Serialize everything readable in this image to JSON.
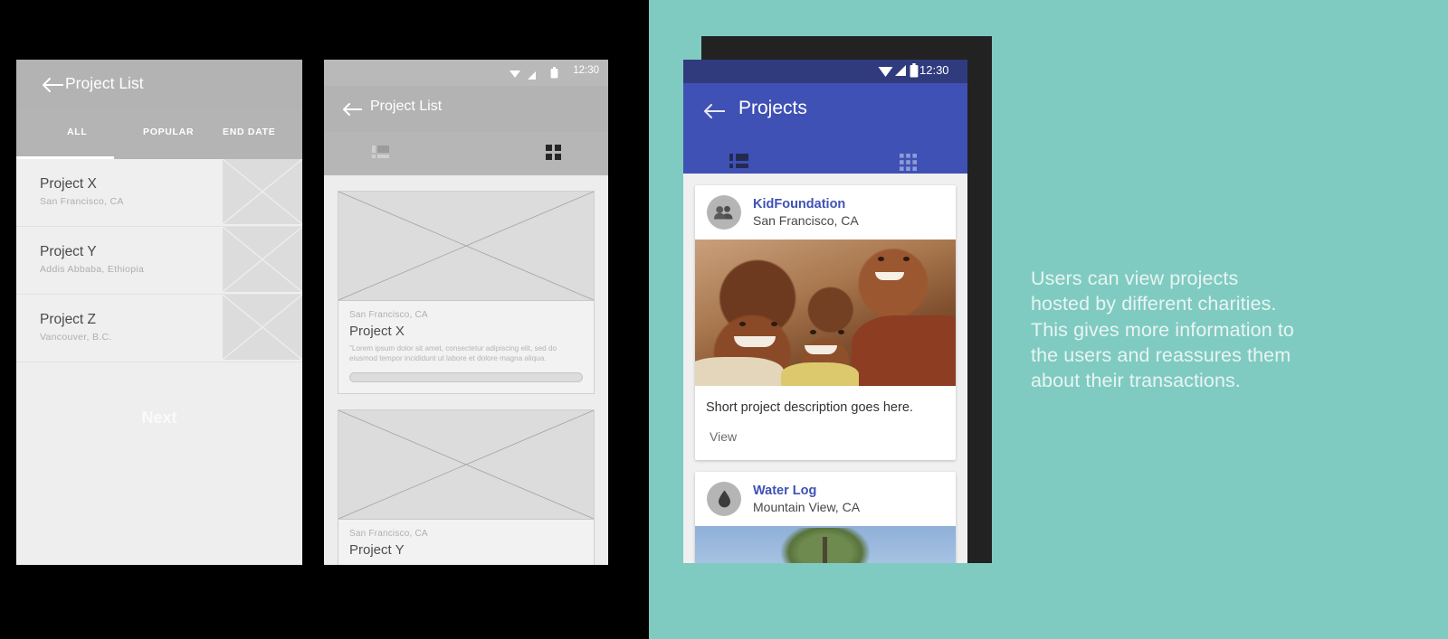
{
  "canvas": {
    "background": "#000000",
    "teal_background": "#7fcbc1"
  },
  "caption": {
    "lines": [
      "Users can view projects",
      "hosted by different charities.",
      "This gives more information to",
      "the users and reassures them",
      "about their transactions."
    ]
  },
  "panel1": {
    "appbar": {
      "title": "Project List",
      "back_icon": "arrow-left-icon"
    },
    "tabs": [
      {
        "label": "ALL",
        "active": true
      },
      {
        "label": "POPULAR",
        "active": false
      },
      {
        "label": "END DATE",
        "active": false
      }
    ],
    "rows": [
      {
        "name": "Project X",
        "location": "San Francisco, CA",
        "thumb_icon": "image-placeholder-icon"
      },
      {
        "name": "Project Y",
        "location": "Addis Abbaba, Ethiopia",
        "thumb_icon": "image-placeholder-icon"
      },
      {
        "name": "Project Z",
        "location": "Vancouver, B.C.",
        "thumb_icon": "image-placeholder-icon"
      }
    ],
    "next_label": "Next"
  },
  "panel2": {
    "status_bar": {
      "time": "12:30",
      "icons": [
        "wifi-icon",
        "signal-icon",
        "battery-icon"
      ]
    },
    "appbar": {
      "title": "Project List",
      "back_icon": "arrow-left-icon"
    },
    "toolbar": {
      "list_view_icon": "list-view-icon",
      "grid_view_icon": "grid-view-icon",
      "active_view": "grid"
    },
    "cards": [
      {
        "location": "San Francisco, CA",
        "name": "Project X",
        "description": "\"Lorem ipsum dolor sit amet, consectetur adipiscing elit, sed do eiusmod tempor incididunt ut labore et dolore magna aliqua.",
        "image_icon": "image-placeholder-icon",
        "action_icon": "button-placeholder"
      },
      {
        "location": "San Francisco, CA",
        "name": "Project Y",
        "description": "",
        "image_icon": "image-placeholder-icon",
        "action_icon": "button-placeholder"
      }
    ]
  },
  "panel3": {
    "colors": {
      "appbar": "#3f51b5",
      "status_bar": "#303b7e",
      "accent": "#3f51b5",
      "frame": "#222222"
    },
    "status_bar": {
      "time": "12:30",
      "icons": [
        "wifi-icon",
        "signal-icon",
        "battery-icon"
      ]
    },
    "appbar": {
      "title": "Projects",
      "back_icon": "arrow-left-icon"
    },
    "toolbar": {
      "list_view_icon": "list-view-icon",
      "grid_view_icon": "grid-view-icon",
      "active_view": "list"
    },
    "cards": [
      {
        "org": "KidFoundation",
        "location": "San Francisco, CA",
        "avatar_icon": "people-group-icon",
        "photo": "children-smiling-photo",
        "description": "Short project description goes here.",
        "action_label": "View"
      },
      {
        "org": "Water Log",
        "location": "Mountain View, CA",
        "avatar_icon": "water-drop-icon",
        "photo": "tree-sky-photo",
        "description": "",
        "action_label": ""
      }
    ]
  }
}
